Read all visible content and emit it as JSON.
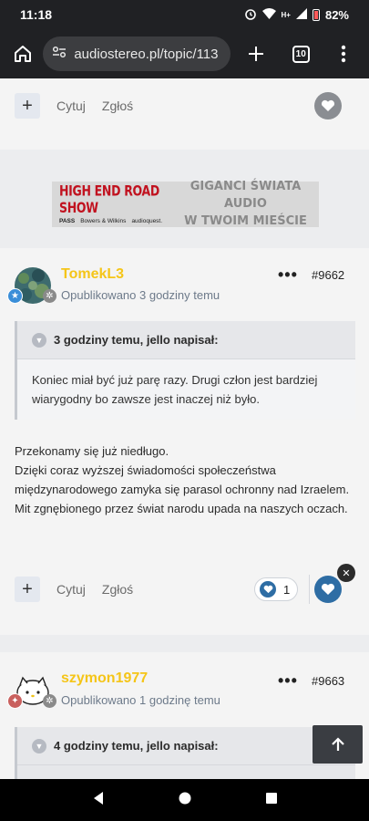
{
  "status": {
    "time": "11:18",
    "network": "H+",
    "battery": "82%"
  },
  "browser": {
    "url": "audiostereo.pl/topic/113",
    "tab_count": "10"
  },
  "top_actions": {
    "quote": "Cytuj",
    "report": "Zgłoś"
  },
  "banner": {
    "title": "HIGH END ROAD SHOW",
    "brands": [
      "PASS",
      "Bowers & Wilkins",
      "audioquest."
    ],
    "tagline_line1": "GIGANCI ŚWIATA AUDIO",
    "tagline_line2": "W TWOIM MIEŚCIE"
  },
  "posts": [
    {
      "username": "TomekL3",
      "published": "Opublikowano 3 godziny temu",
      "post_number": "#9662",
      "quote_header": "3 godziny temu, jello napisał:",
      "quote_text": "Koniec miał być już parę razy. Drugi człon jest bardziej wiarygodny bo zawsze jest inaczej niż było.",
      "body_lines": [
        "Przekonamy się już niedługo.",
        "Dzięki coraz wyższej świadomości społeczeństwa międzynarodowego zamyka się parasol ochronny nad Izraelem. Mit zgnębionego przez świat narodu upada na naszych oczach."
      ],
      "quote_label": "Cytuj",
      "report_label": "Zgłoś",
      "reaction_count": "1"
    },
    {
      "username": "szymon1977",
      "published": "Opublikowano 1 godzinę temu",
      "post_number": "#9663",
      "quote_header": "4 godziny temu, jello napisał:"
    }
  ],
  "colors": {
    "accent": "#2e6da4",
    "username": "#f5c518",
    "banner_red": "#c1121f"
  }
}
